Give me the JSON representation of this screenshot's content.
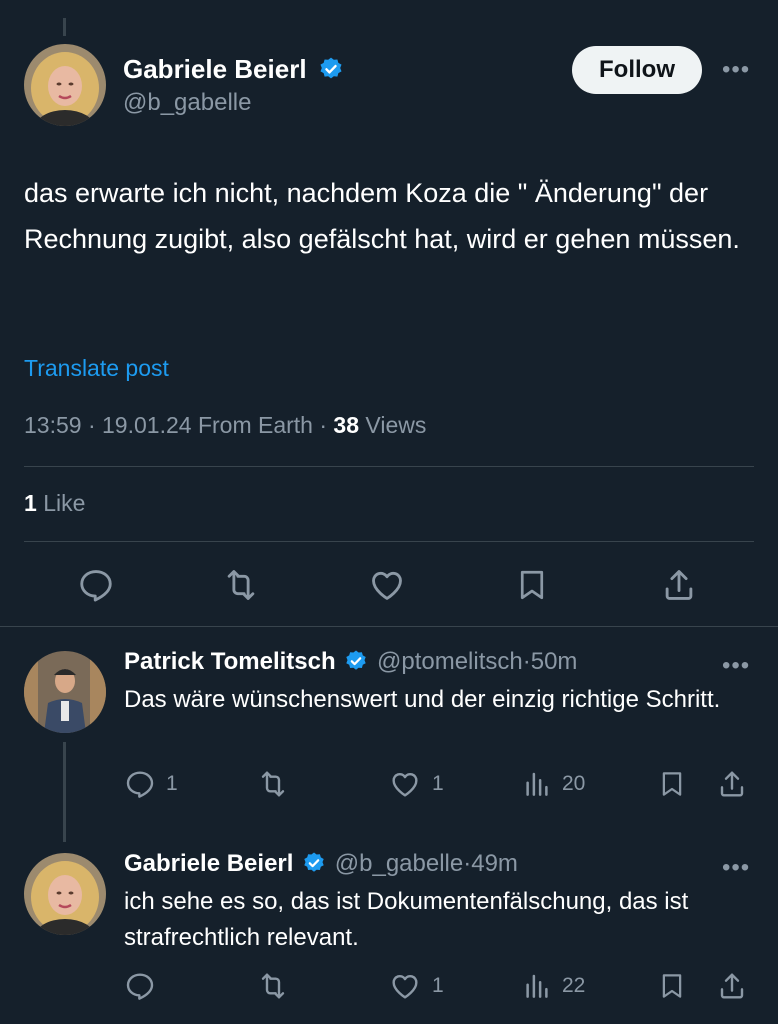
{
  "tweet": {
    "author_name": "Gabriele Beierl",
    "author_handle": "@b_gabelle",
    "follow_label": "Follow",
    "more_label": "•••",
    "text": "das erwarte ich nicht, nachdem Koza die \" Änderung\" der Rechnung zugibt, also gefälscht hat, wird er gehen müssen.",
    "translate_label": "Translate post",
    "time": "13:59",
    "date": "19.01.24",
    "source": "From Earth",
    "views_count": "38",
    "views_label": "Views",
    "likes_count": "1",
    "likes_label": "Like"
  },
  "replies": [
    {
      "author_name": "Patrick Tomelitsch",
      "author_handle": "@ptomelitsch",
      "time": "50m",
      "text": "Das wäre wünschenswert und der einzig richtige Schritt.",
      "reply_count": "1",
      "like_count": "1",
      "view_count": "20"
    },
    {
      "author_name": "Gabriele Beierl",
      "author_handle": "@b_gabelle",
      "time": "49m",
      "text": "ich sehe es so, das ist Dokumentenfälschung, das ist strafrechtlich relevant.",
      "reply_count": "",
      "like_count": "1",
      "view_count": "22"
    }
  ],
  "separator": "·",
  "colors": {
    "background": "#15202b",
    "accent": "#1d9bf0",
    "muted": "#8b98a5",
    "divider": "#38444d"
  }
}
